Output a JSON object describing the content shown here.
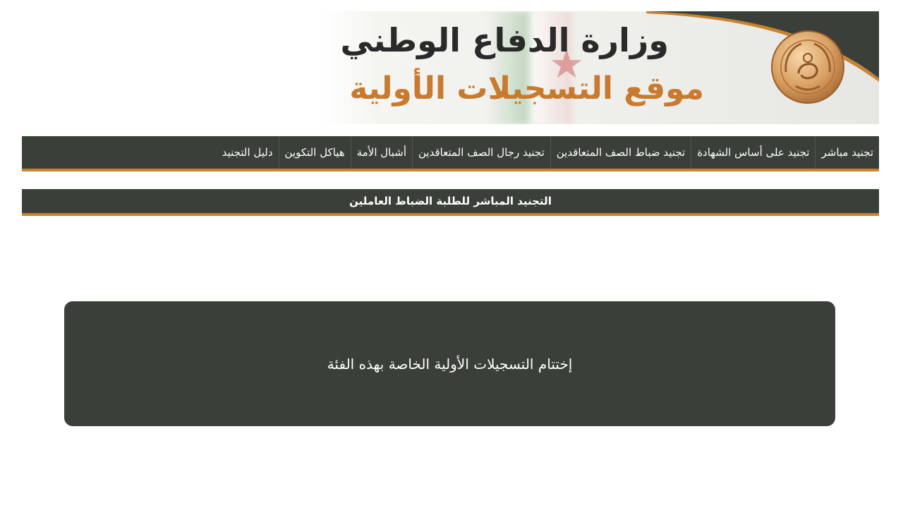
{
  "banner": {
    "title": "وزارة الدفاع الوطني",
    "subtitle": "موقع التسجيلات الأولية",
    "emblem_icon": "ministry-emblem-icon",
    "accent_color": "#c87a2e"
  },
  "nav": {
    "items": [
      {
        "label": "تجنيد مباشر"
      },
      {
        "label": "تجنيد على أساس الشهادة"
      },
      {
        "label": "تجنيد ضباط الصف المتعاقدين"
      },
      {
        "label": "تجنيد رجال الصف المتعاقدين"
      },
      {
        "label": "أشبال الأمة"
      },
      {
        "label": "هياكل التكوين"
      },
      {
        "label": "دليل التجنيد"
      }
    ]
  },
  "section": {
    "title": "التجنيد المباشر للطلبة الضباط العاملين"
  },
  "message": {
    "text": "إختتام التسجيلات الأولية الخاصة بهذه الفئة"
  },
  "colors": {
    "bar_background": "#3b3f3a",
    "bar_accent": "#c9822e"
  }
}
